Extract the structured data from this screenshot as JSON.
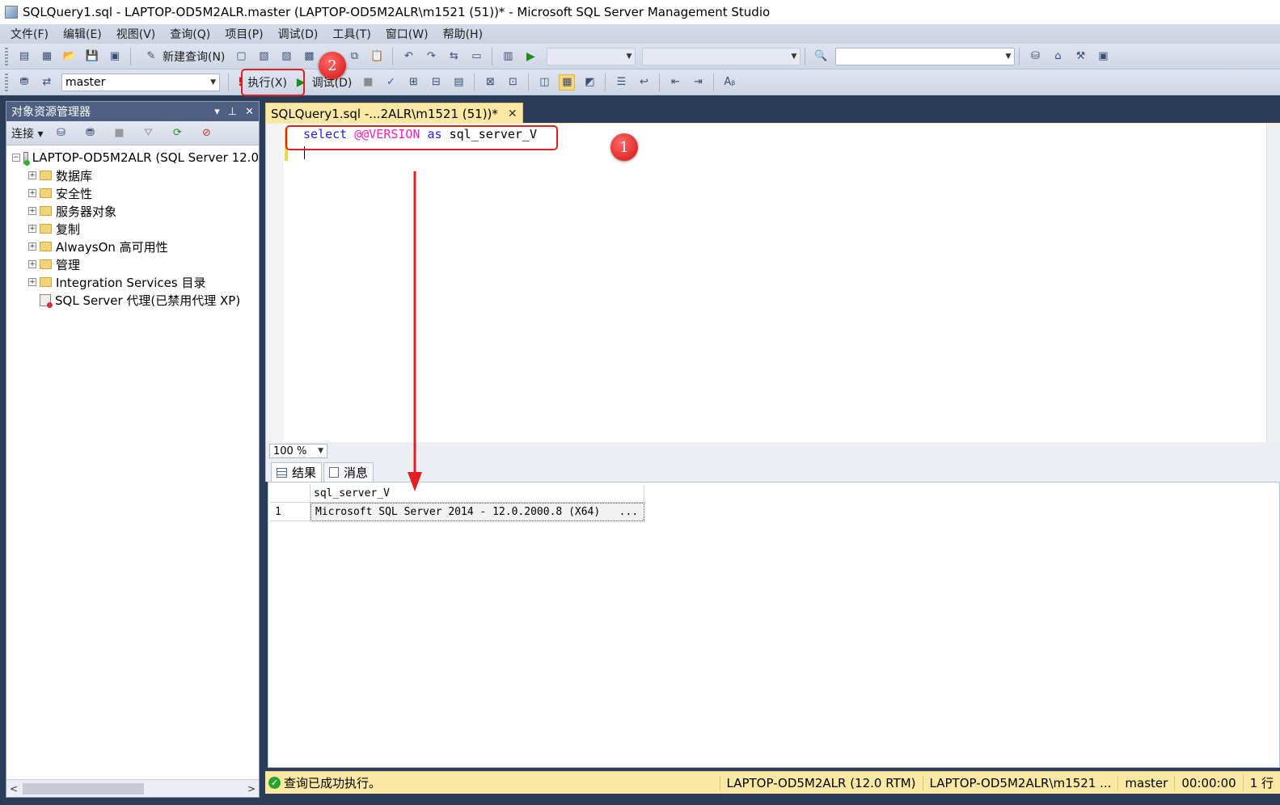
{
  "window": {
    "title": "SQLQuery1.sql - LAPTOP-OD5M2ALR.master (LAPTOP-OD5M2ALR\\m1521 (51))* - Microsoft SQL Server Management Studio"
  },
  "menu": [
    "文件(F)",
    "编辑(E)",
    "视图(V)",
    "查询(Q)",
    "项目(P)",
    "调试(D)",
    "工具(T)",
    "窗口(W)",
    "帮助(H)"
  ],
  "toolbar1": {
    "new_query": "新建查询(N)"
  },
  "toolbar2": {
    "database": "master",
    "execute": "执行(X)",
    "debug": "调试(D)"
  },
  "object_explorer": {
    "title": "对象资源管理器",
    "connect": "连接",
    "server": "LAPTOP-OD5M2ALR (SQL Server 12.0",
    "nodes": [
      "数据库",
      "安全性",
      "服务器对象",
      "复制",
      "AlwaysOn 高可用性",
      "管理",
      "Integration Services 目录"
    ],
    "agent": "SQL Server 代理(已禁用代理 XP)"
  },
  "editor": {
    "tab_title": "SQLQuery1.sql -...2ALR\\m1521 (51))*",
    "code_keyword1": "select",
    "code_sysvar": "@@VERSION",
    "code_keyword2": "as",
    "code_alias": "sql_server_V",
    "zoom": "100 %"
  },
  "results": {
    "tabs": [
      "结果",
      "消息"
    ],
    "column": "sql_server_V",
    "row_number": "1",
    "value": "Microsoft SQL Server 2014 - 12.0.2000.8 (X64)   ..."
  },
  "status": {
    "message": "查询已成功执行。",
    "server": "LAPTOP-OD5M2ALR (12.0 RTM)",
    "user": "LAPTOP-OD5M2ALR\\m1521 ...",
    "database": "master",
    "elapsed": "00:00:00",
    "rows": "1 行"
  },
  "annotations": {
    "step1": "1",
    "step2": "2",
    "accent_color": "#e02020"
  },
  "colors": {
    "chrome_dark": "#2b3c59",
    "editor_tab": "#fbe9a3",
    "keyword": "#1f1fff",
    "system_variable": "#ff1fbf"
  }
}
